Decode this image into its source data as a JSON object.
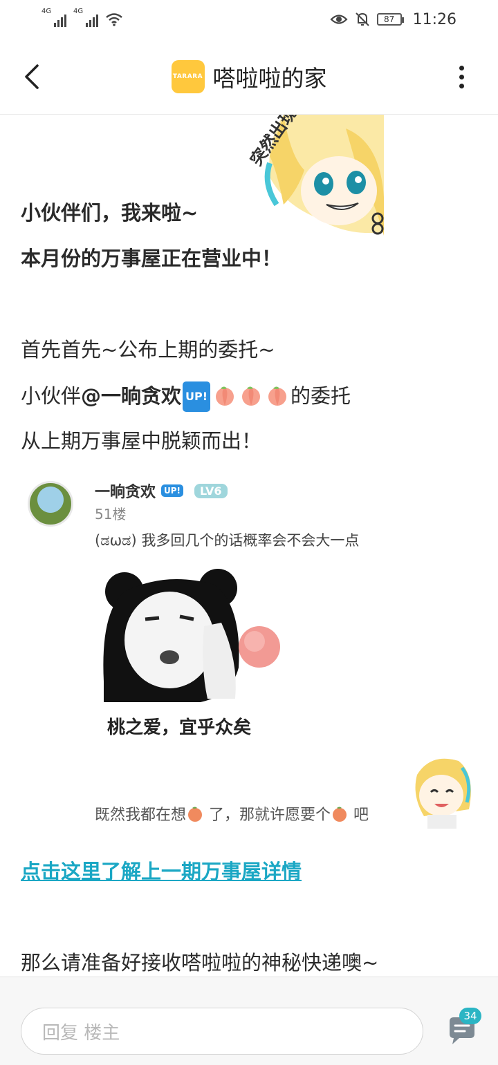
{
  "status_bar": {
    "signal1_label": "4G",
    "signal2_label": "4G",
    "battery": "87",
    "time": "11:26"
  },
  "nav": {
    "logo_text": "TARARA",
    "title": "嗒啦啦的家"
  },
  "post": {
    "line1": "小伙伴们，我来啦~",
    "line2": "本月份的万事屋正在营业中！",
    "line3": "首先首先~公布上期的委托~",
    "line4_prefix": "小伙伴",
    "line4_mention": "@一晌贪欢",
    "line4_badge": "UP!",
    "line4_suffix": "的委托",
    "line5": "从上期万事屋中脱颖而出！",
    "link": "点击这里了解上一期万事屋详情",
    "line6": "那么请准备好接收嗒啦啦的神秘快递噢~",
    "sticker_text": "突然出现"
  },
  "quoted_comment": {
    "username": "一晌贪欢",
    "badge": "UP!",
    "level": "LV6",
    "floor": "51楼",
    "text": "(ಡωಡ) 我多回几个的话概率会不会大一点",
    "meme_caption": "桃之爱，宜乎众矣",
    "text2_part1": "既然我都在想",
    "text2_part2": " 了，那就许愿要个",
    "text2_part3": " 吧"
  },
  "bottom_bar": {
    "reply_placeholder": "回复  楼主",
    "comment_count": "34"
  },
  "colors": {
    "link": "#1aa7c4",
    "logo_bg": "#ffc83d",
    "badge_bg": "#2bb5c4"
  }
}
